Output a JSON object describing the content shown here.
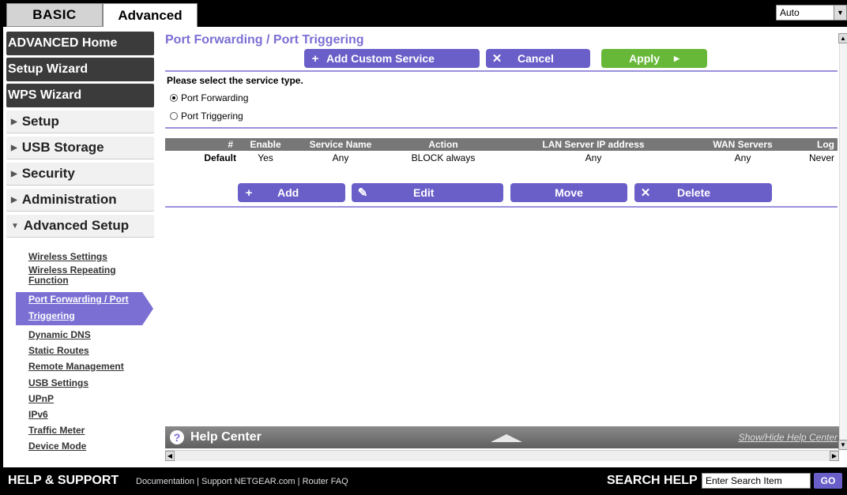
{
  "tabs": {
    "basic": "BASIC",
    "advanced": "Advanced"
  },
  "language": {
    "selected": "Auto"
  },
  "sidebar": {
    "dark_items": [
      "ADVANCED Home",
      "Setup Wizard",
      "WPS Wizard"
    ],
    "light_items": [
      "Setup",
      "USB Storage",
      "Security",
      "Administration",
      "Advanced Setup"
    ],
    "sub_items": [
      "Wireless Settings",
      "Wireless Repeating",
      "Function",
      "Port Forwarding / Port",
      "Triggering",
      "Dynamic DNS",
      "Static Routes",
      "Remote Management",
      "USB Settings",
      "UPnP",
      "IPv6",
      "Traffic Meter",
      "Device Mode"
    ]
  },
  "main": {
    "title": "Port Forwarding / Port Triggering",
    "add_custom_label": "Add Custom Service",
    "cancel_label": "Cancel",
    "apply_label": "Apply",
    "prompt": "Please select the service type.",
    "radio_forwarding": "Port Forwarding",
    "radio_triggering": "Port Triggering",
    "table": {
      "headers": [
        "#",
        "Enable",
        "Service Name",
        "Action",
        "LAN Server IP address",
        "WAN Servers",
        "Log"
      ],
      "row": [
        "Default",
        "Yes",
        "Any",
        "BLOCK always",
        "Any",
        "Any",
        "Never"
      ]
    },
    "add_label": "Add",
    "edit_label": "Edit",
    "move_label": "Move",
    "delete_label": "Delete"
  },
  "help": {
    "title": "Help Center",
    "toggle": "Show/Hide Help Center"
  },
  "footer": {
    "help_support": "HELP & SUPPORT",
    "doc": "Documentation",
    "support": "Support NETGEAR.com",
    "faq": "Router FAQ",
    "search_label": "SEARCH HELP",
    "search_value": "Enter Search Item",
    "go": "GO"
  },
  "colors": {
    "accent": "#6a5ec8",
    "apply": "#67b838",
    "title": "#7b6fd4"
  }
}
